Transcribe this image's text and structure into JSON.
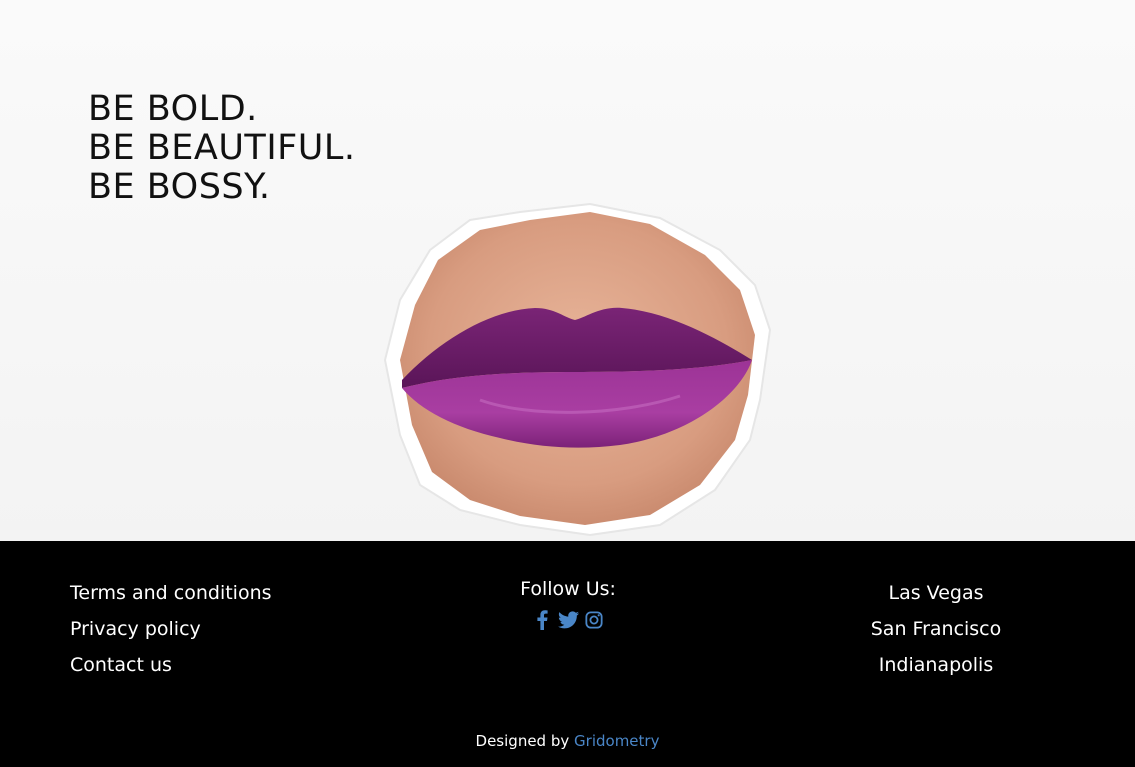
{
  "hero": {
    "tagline": [
      "BE BOLD.",
      "BE BEAUTIFUL.",
      "BE BOSSY."
    ],
    "image_subject": "lips-through-torn-paper"
  },
  "footer": {
    "links": [
      "Terms and conditions",
      "Privacy policy",
      "Contact us"
    ],
    "follow_label": "Follow Us:",
    "social_icons": [
      "facebook-icon",
      "twitter-icon",
      "instagram-icon"
    ],
    "cities": [
      "Las Vegas",
      "San Francisco",
      "Indianapolis"
    ],
    "credit_prefix": "Designed by",
    "credit_brand": "Gridometry"
  },
  "colors": {
    "footer_bg": "#000000",
    "link_accent": "#4a86c7",
    "lip_color": "#8b2a86"
  }
}
